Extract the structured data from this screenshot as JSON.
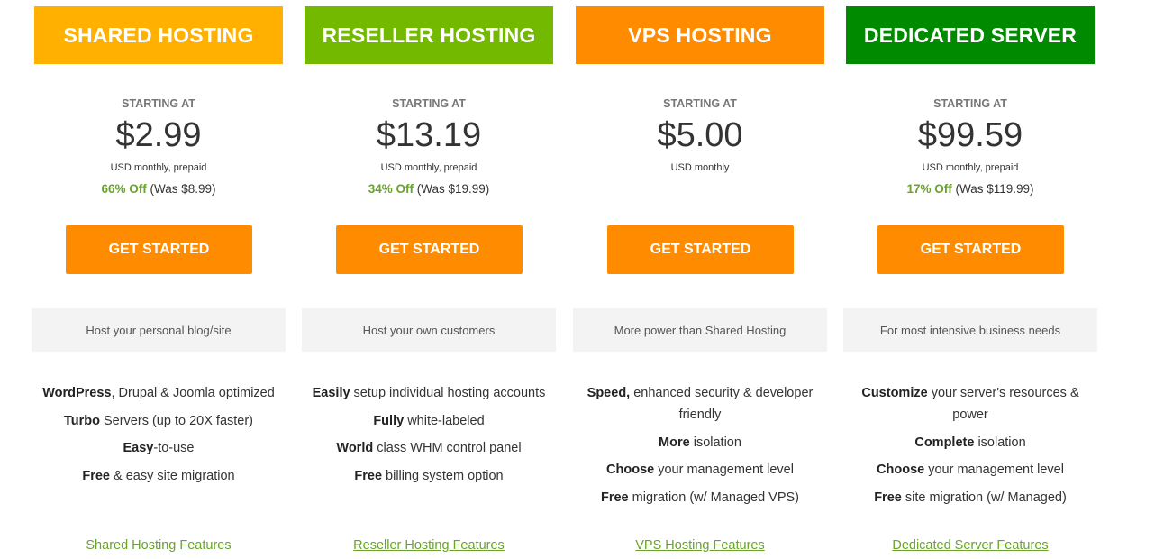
{
  "colors": {
    "shared": "#ffb000",
    "reseller": "#72b900",
    "vps": "#ff8c00",
    "dedicated": "#008a00",
    "button": "#ff8c00",
    "discount_green": "#6aa22c"
  },
  "plans": [
    {
      "title": "SHARED HOSTING",
      "starting_label": "STARTING AT",
      "price": "$2.99",
      "billing": "USD monthly, prepaid",
      "discount": "66% Off",
      "was": "(Was $8.99)",
      "button_label": "GET STARTED",
      "tagline": "Host your personal blog/site",
      "features": [
        {
          "bold": "WordPress",
          "text": ", Drupal & Joomla optimized"
        },
        {
          "bold": "Turbo",
          "text": " Servers (up to 20X faster)"
        },
        {
          "bold": "Easy",
          "text": "-to-use"
        },
        {
          "bold": "Free",
          "text": " & easy site migration"
        }
      ],
      "link": "Shared Hosting Features"
    },
    {
      "title": "RESELLER HOSTING",
      "starting_label": "STARTING AT",
      "price": "$13.19",
      "billing": "USD monthly, prepaid",
      "discount": "34% Off",
      "was": "(Was $19.99)",
      "button_label": "GET STARTED",
      "tagline": "Host your own customers",
      "features": [
        {
          "bold": "Easily",
          "text": " setup individual hosting accounts"
        },
        {
          "bold": "Fully",
          "text": " white-labeled"
        },
        {
          "bold": "World",
          "text": " class WHM control panel"
        },
        {
          "bold": "Free",
          "text": " billing system option"
        }
      ],
      "link": "Reseller Hosting Features"
    },
    {
      "title": "VPS HOSTING",
      "starting_label": "STARTING AT",
      "price": "$5.00",
      "billing": "USD monthly",
      "discount": "",
      "was": "",
      "button_label": "GET STARTED",
      "tagline": "More power than Shared Hosting",
      "features": [
        {
          "bold": "Speed,",
          "text": " enhanced security & developer friendly"
        },
        {
          "bold": "More",
          "text": " isolation"
        },
        {
          "bold": "Choose",
          "text": " your management level"
        },
        {
          "bold": "Free",
          "text": " migration (w/ Managed VPS)"
        }
      ],
      "link": "VPS Hosting Features"
    },
    {
      "title": "DEDICATED SERVER",
      "starting_label": "STARTING AT",
      "price": "$99.59",
      "billing": "USD monthly, prepaid",
      "discount": "17% Off",
      "was": "(Was $119.99)",
      "button_label": "GET STARTED",
      "tagline": "For most intensive business needs",
      "features": [
        {
          "bold": "Customize",
          "text": " your server's resources & power"
        },
        {
          "bold": "Complete",
          "text": " isolation"
        },
        {
          "bold": "Choose",
          "text": " your management level"
        },
        {
          "bold": "Free",
          "text": " site migration (w/ Managed)"
        }
      ],
      "link": "Dedicated Server Features"
    }
  ]
}
